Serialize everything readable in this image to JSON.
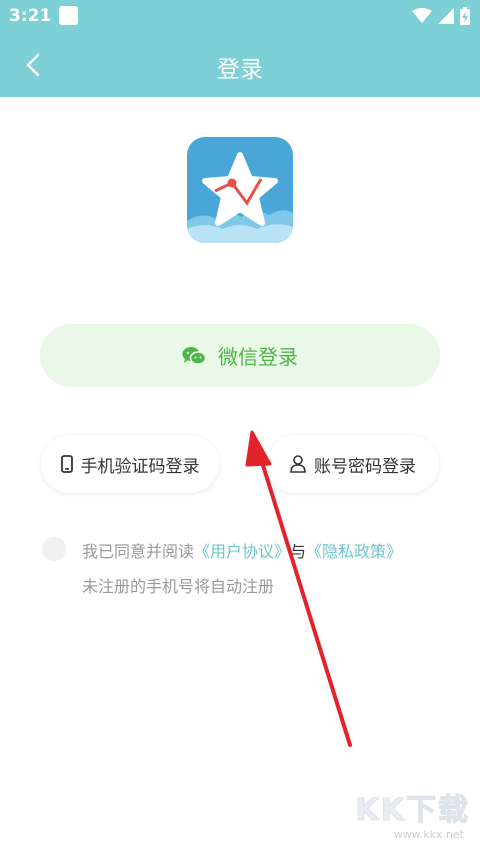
{
  "status_bar": {
    "time": "3:21",
    "icons": [
      "wifi-icon",
      "signal-icon",
      "battery-icon"
    ]
  },
  "header": {
    "title": "登录",
    "back_icon": "chevron-left-icon"
  },
  "logo": {
    "icon": "star-chart-app-icon"
  },
  "wechat_login": {
    "label": "微信登录",
    "icon": "wechat-icon"
  },
  "phone_login": {
    "label": "手机验证码登录",
    "icon": "phone-icon"
  },
  "account_login": {
    "label": "账号密码登录",
    "icon": "user-icon"
  },
  "agreement": {
    "prefix": "我已同意并阅读",
    "user_agreement": "《用户协议》",
    "and": "与",
    "privacy_policy": "《隐私政策》",
    "note": "未注册的手机号将自动注册"
  },
  "watermark": {
    "logo_text": "KK下载",
    "url": "www.kkx.net"
  },
  "colors": {
    "header": "#7dd0d5",
    "wechat_green": "#4eb548",
    "wechat_bg": "#e9f8e7",
    "link": "#6ec6cc",
    "annotation_arrow": "#e3232b"
  }
}
